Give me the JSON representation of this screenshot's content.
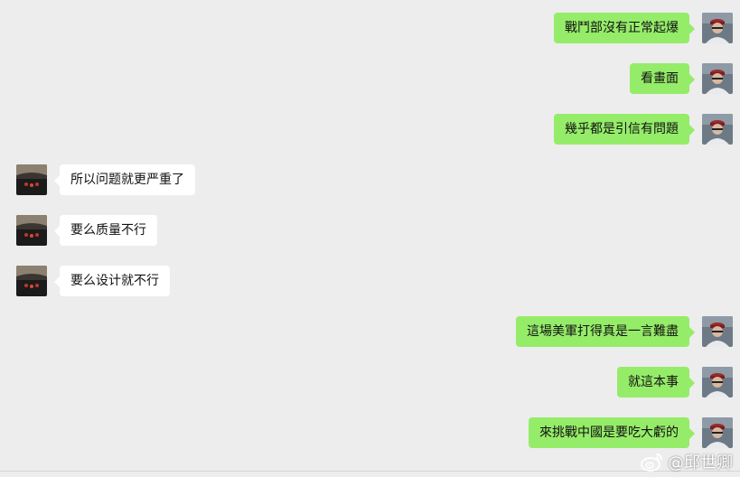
{
  "messages": [
    {
      "side": "right",
      "text": "戰鬥部沒有正常起爆"
    },
    {
      "side": "right",
      "text": "看畫面"
    },
    {
      "side": "right",
      "text": "幾乎都是引信有問題"
    },
    {
      "side": "left",
      "text": "所以问题就更严重了"
    },
    {
      "side": "left",
      "text": "要么质量不行"
    },
    {
      "side": "left",
      "text": "要么设计就不行"
    },
    {
      "side": "right",
      "text": "這場美軍打得真是一言難盡"
    },
    {
      "side": "right",
      "text": "就這本事"
    },
    {
      "side": "right",
      "text": "來挑戰中國是要吃大虧的"
    }
  ],
  "watermark": {
    "text": "@邱世卿",
    "icon": "weibo-icon"
  },
  "colors": {
    "background": "#ededed",
    "self_bubble": "#95ec69",
    "other_bubble": "#ffffff"
  }
}
